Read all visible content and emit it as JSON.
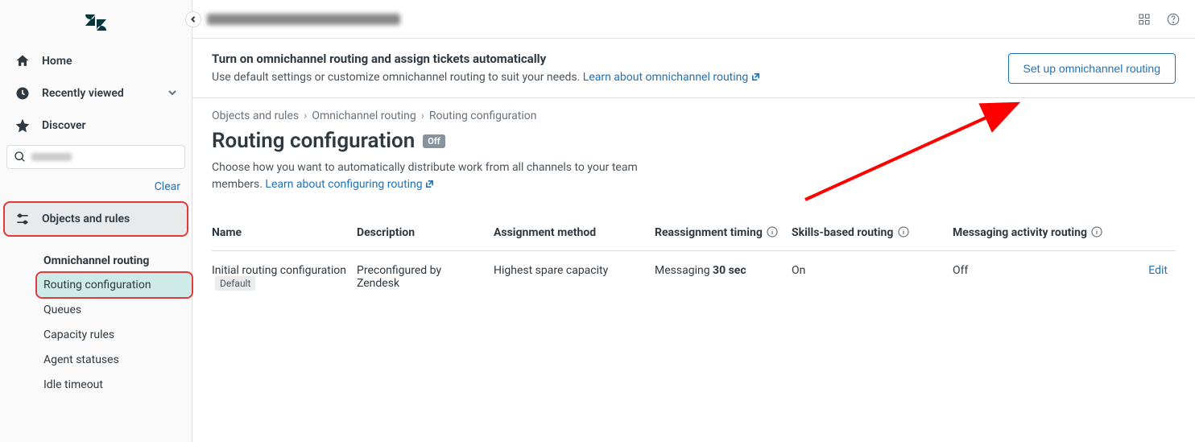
{
  "sidebar": {
    "nav": {
      "home": "Home",
      "recent": "Recently viewed",
      "discover": "Discover"
    },
    "clear": "Clear",
    "section": "Objects and rules",
    "subhead": "Omnichannel routing",
    "subitems": [
      "Routing configuration",
      "Queues",
      "Capacity rules",
      "Agent statuses",
      "Idle timeout"
    ]
  },
  "banner": {
    "title": "Turn on omnichannel routing and assign tickets automatically",
    "desc": "Use default settings or customize omnichannel routing to suit your needs. ",
    "link": "Learn about omnichannel routing",
    "button": "Set up omnichannel routing"
  },
  "breadcrumb": [
    "Objects and rules",
    "Omnichannel routing",
    "Routing configuration"
  ],
  "page": {
    "title": "Routing configuration",
    "badge": "Off",
    "desc": "Choose how you want to automatically distribute work from all channels to your team members. ",
    "link": "Learn about configuring routing"
  },
  "table": {
    "headers": [
      "Name",
      "Description",
      "Assignment method",
      "Reassignment timing",
      "Skills-based routing",
      "Messaging activity routing",
      ""
    ],
    "row": {
      "name": "Initial routing configuration",
      "default": "Default",
      "desc": "Preconfigured by Zendesk",
      "method": "Highest spare capacity",
      "timing_prefix": "Messaging ",
      "timing_bold": "30 sec",
      "skills": "On",
      "activity": "Off",
      "edit": "Edit"
    }
  }
}
